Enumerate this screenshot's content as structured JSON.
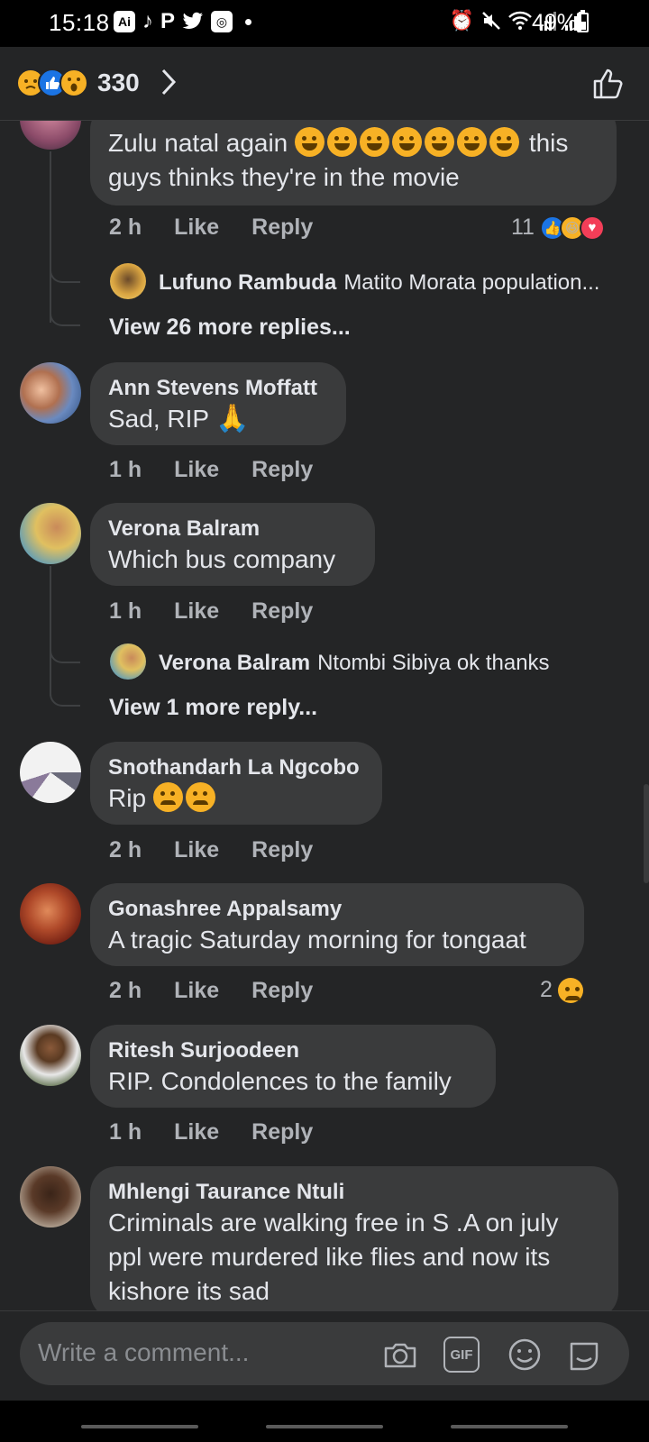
{
  "status_bar": {
    "time": "15:18",
    "left_icons": [
      "ai-app-icon",
      "tiktok-icon",
      "pinterest-icon",
      "twitter-icon",
      "camera-app-icon"
    ],
    "right_icons": [
      "alarm-icon",
      "mute-icon",
      "wifi-icon",
      "signal-icon",
      "signal-icon"
    ],
    "battery": "49%",
    "battery_level": 0.49
  },
  "header": {
    "reaction_icons": [
      "sad-reaction",
      "like-reaction",
      "wow-reaction"
    ],
    "reaction_count": "330",
    "like_icon": "thumbs-up-icon"
  },
  "comments": [
    {
      "text_line1": "Zulu natal again",
      "emoji_count": 7,
      "text_after_emoji": "this",
      "text_line2": "guys thinks they're in the movie",
      "time": "2 h",
      "like": "Like",
      "reply": "Reply",
      "reaction_count": "11",
      "reply_preview": {
        "name": "Lufuno Rambuda",
        "text": "Matito Morata population..."
      },
      "view_more": "View 26 more replies..."
    },
    {
      "name": "Ann Stevens Moffatt",
      "text": "Sad, RIP",
      "time": "1 h",
      "like": "Like",
      "reply": "Reply"
    },
    {
      "name": "Verona Balram",
      "text": "Which bus company",
      "time": "1 h",
      "like": "Like",
      "reply": "Reply",
      "reply_preview": {
        "name": "Verona Balram",
        "text": "Ntombi Sibiya ok thanks"
      },
      "view_more": "View 1 more reply..."
    },
    {
      "name": "Snothandarh La Ngcobo",
      "text": "Rip",
      "time": "2 h",
      "like": "Like",
      "reply": "Reply"
    },
    {
      "name": "Gonashree Appalsamy",
      "text": "A tragic Saturday morning for tongaat",
      "time": "2 h",
      "like": "Like",
      "reply": "Reply",
      "reaction_count": "2"
    },
    {
      "name": "Ritesh Surjoodeen",
      "text": "RIP. Condolences to the family",
      "time": "1 h",
      "like": "Like",
      "reply": "Reply"
    },
    {
      "name": "Mhlengi Taurance Ntuli",
      "text_lines": [
        "Criminals are walking free in S .A on july",
        "ppl were murdered like flies and now its",
        "kishore its sad"
      ]
    }
  ],
  "composer": {
    "placeholder": "Write a comment...",
    "icons": [
      "camera-icon",
      "gif-icon",
      "emoji-icon",
      "sticker-icon"
    ],
    "gif_label": "GIF"
  },
  "colors": {
    "background": "#242526",
    "bubble": "#3a3b3c",
    "text": "#e4e6eb",
    "secondary_text": "#b0b3b8",
    "like_blue": "#1b74e4",
    "reaction_yellow": "#f7b125",
    "love_red": "#f33e58"
  }
}
